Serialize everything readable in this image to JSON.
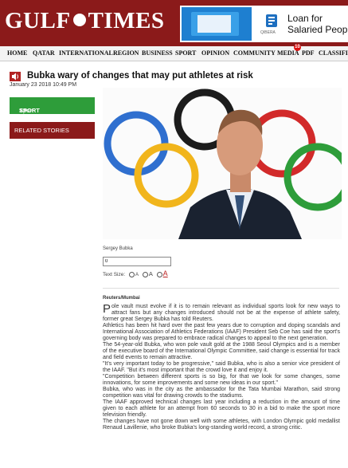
{
  "header": {
    "logo_left": "GULF",
    "logo_right": "TIMES",
    "ad": {
      "line1": "Loan for",
      "line2": "Salaried People",
      "brand": "QIBERA"
    }
  },
  "nav": {
    "items": [
      "HOME",
      "QATAR",
      "INTERNATIONAL",
      "REGION",
      "BUSINESS",
      "SPORT",
      "OPINION",
      "COMMUNITY",
      "MEDIA",
      "PDF",
      "CLASSIFIED"
    ],
    "media_badge": "10"
  },
  "article": {
    "headline": "Bubka wary of changes that may put athletes at risk",
    "date": "January 23 2018 10:49 PM",
    "caption": "Sergey Bubka",
    "page_value": "0",
    "textsize_label": "Text Size:",
    "textsize_options": [
      "A",
      "A",
      "A"
    ],
    "source": "Reuters/Mumbai",
    "dropcap": "P",
    "paragraphs": [
      "ole vault must evolve if it is to remain relevant as individual sports look for new ways to attract fans but any changes introduced should not be at the expense of athlete safety, former great Sergey Bubka has told Reuters.",
      "Athletics has been hit hard over the past few years due to corruption and doping scandals and International Association of Athletics Federations (IAAF) President Seb Coe has said the sport's governing body was prepared to embrace radical changes to appeal to the next generation.",
      "The 54-year-old Bubka, who won pole vault gold at the 1988 Seoul Olympics and is a member of the executive board of the International Olympic Committee, said change is essential for track and field events to remain attractive.",
      "\"It's very important today to be progressive,\" said Bubka, who is also a senior vice president of the IAAF. \"But it's most important that the crowd love it and enjoy it.",
      "\"Competition between different sports is so big, for that we look for some changes, some innovations, for some improvements and some new ideas in our sport.\"",
      "Bubka, who was in the city as the ambassador for the Tata Mumbai Marathon, said strong competition was vital for drawing crowds to the stadiums.",
      "The IAAF approved technical changes last year including a reduction in the amount of time given to each athlete for an attempt from 60 seconds to 30 in a bid to make the sport more television friendly.",
      "The changes have not gone down well with some athletes, with London Olympic gold medallist Renaud Lavillenie, who broke Bubka's long-standing world record, a strong critic."
    ]
  },
  "sidebar": {
    "sport_label": "SPORT",
    "sport_arrow": ">>",
    "sport_sub": "Sport",
    "related_label": "RELATED STORIES"
  },
  "colors": {
    "brand": "#8b1a1a",
    "sport_green": "#2e9d3a"
  }
}
